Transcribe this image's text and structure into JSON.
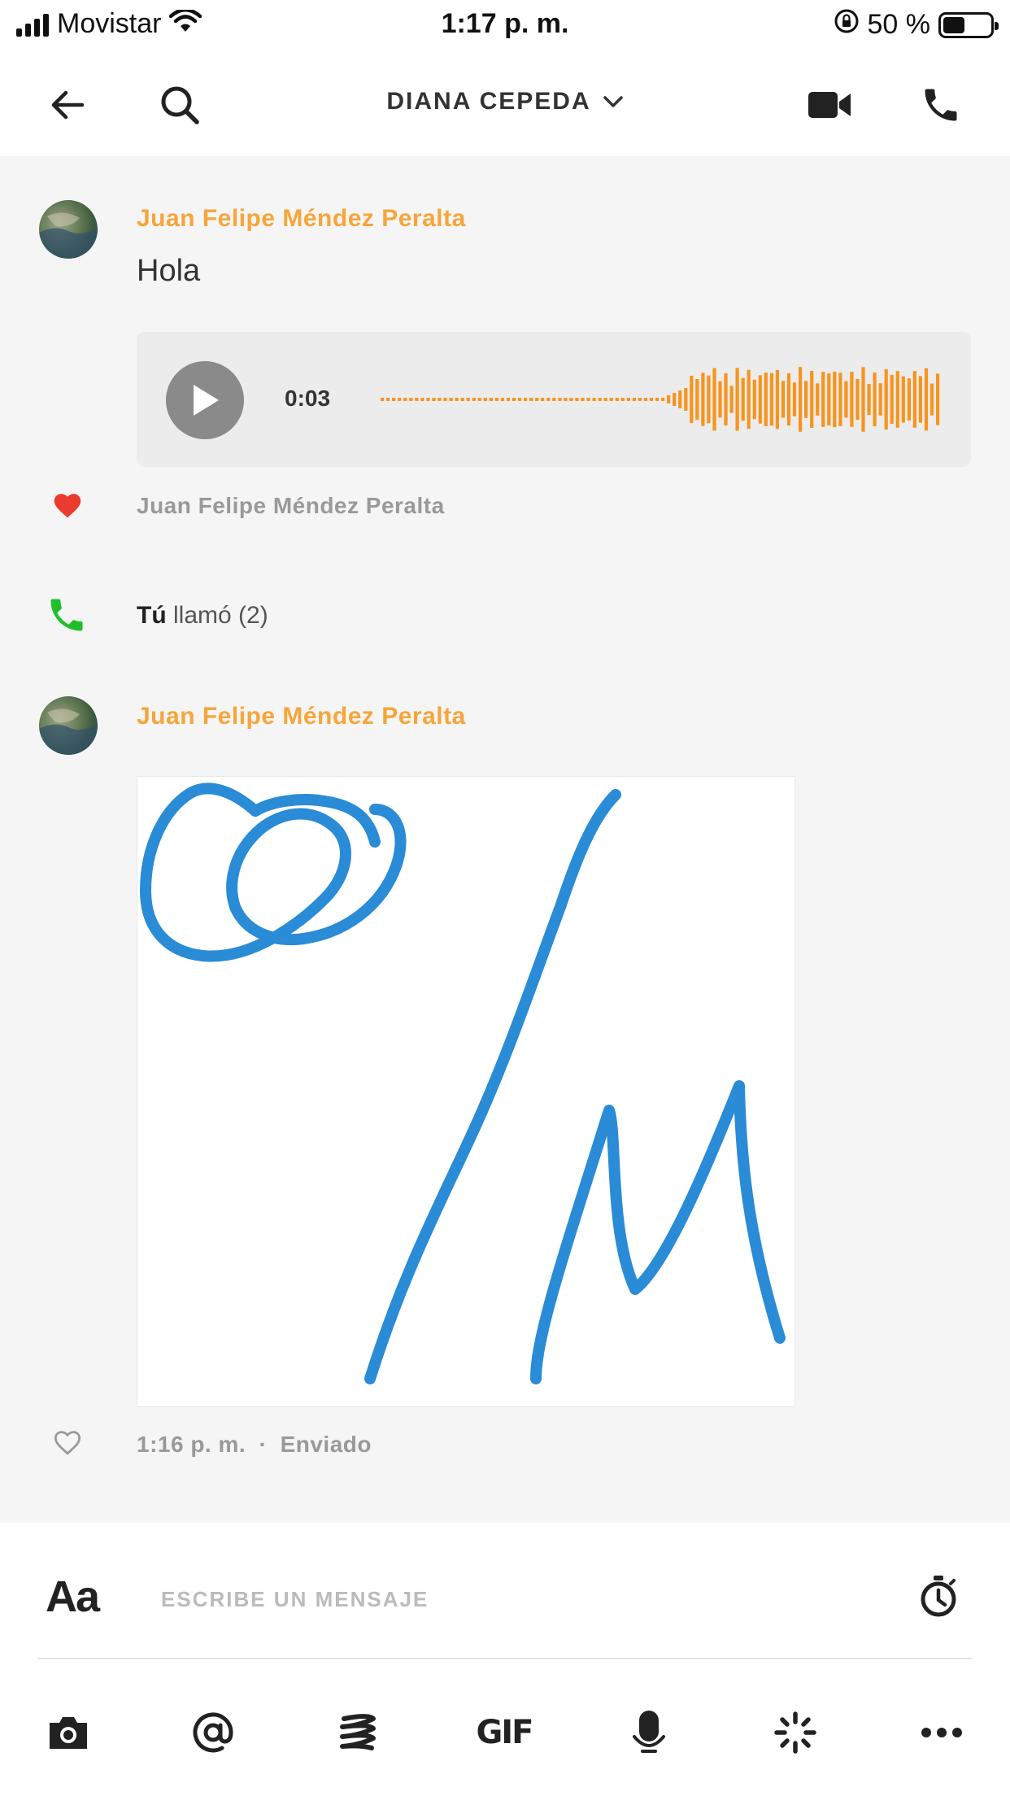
{
  "status_bar": {
    "carrier": "Movistar",
    "time": "1:17 p. m.",
    "battery_text": "50 %",
    "battery_level": 0.5
  },
  "header": {
    "title": "DIANA CEPEDA",
    "icons": [
      "back-arrow-icon",
      "search-icon",
      "chevron-down-icon",
      "video-camera-icon",
      "phone-icon"
    ]
  },
  "messages": [
    {
      "sender": "Juan Felipe Méndez Peralta",
      "text": "Hola",
      "audio": {
        "duration": "0:03"
      },
      "reaction": {
        "icon": "heart-filled-icon",
        "by": "Juan Felipe Méndez Peralta"
      }
    },
    {
      "call": {
        "who": "Tú",
        "action": "llamó (2)"
      }
    },
    {
      "sender": "Juan Felipe Méndez Peralta",
      "drawing": "sketch",
      "meta": {
        "time": "1:16 p. m.",
        "separator": "·",
        "status": "Enviado"
      }
    }
  ],
  "composer": {
    "format_label": "Aa",
    "placeholder": "ESCRIBE UN MENSAJE",
    "value": "",
    "tools": [
      "camera-icon",
      "mention-icon",
      "scribble-icon",
      "gif-icon",
      "microphone-icon",
      "sparkle-icon",
      "more-icon"
    ],
    "gif_label": "GIF"
  },
  "colors": {
    "sender": "#f7a53a",
    "wave": "#f7941d",
    "heart": "#ea3b2e",
    "call": "#1fbf2a",
    "drawing_stroke": "#2a8bd6"
  }
}
